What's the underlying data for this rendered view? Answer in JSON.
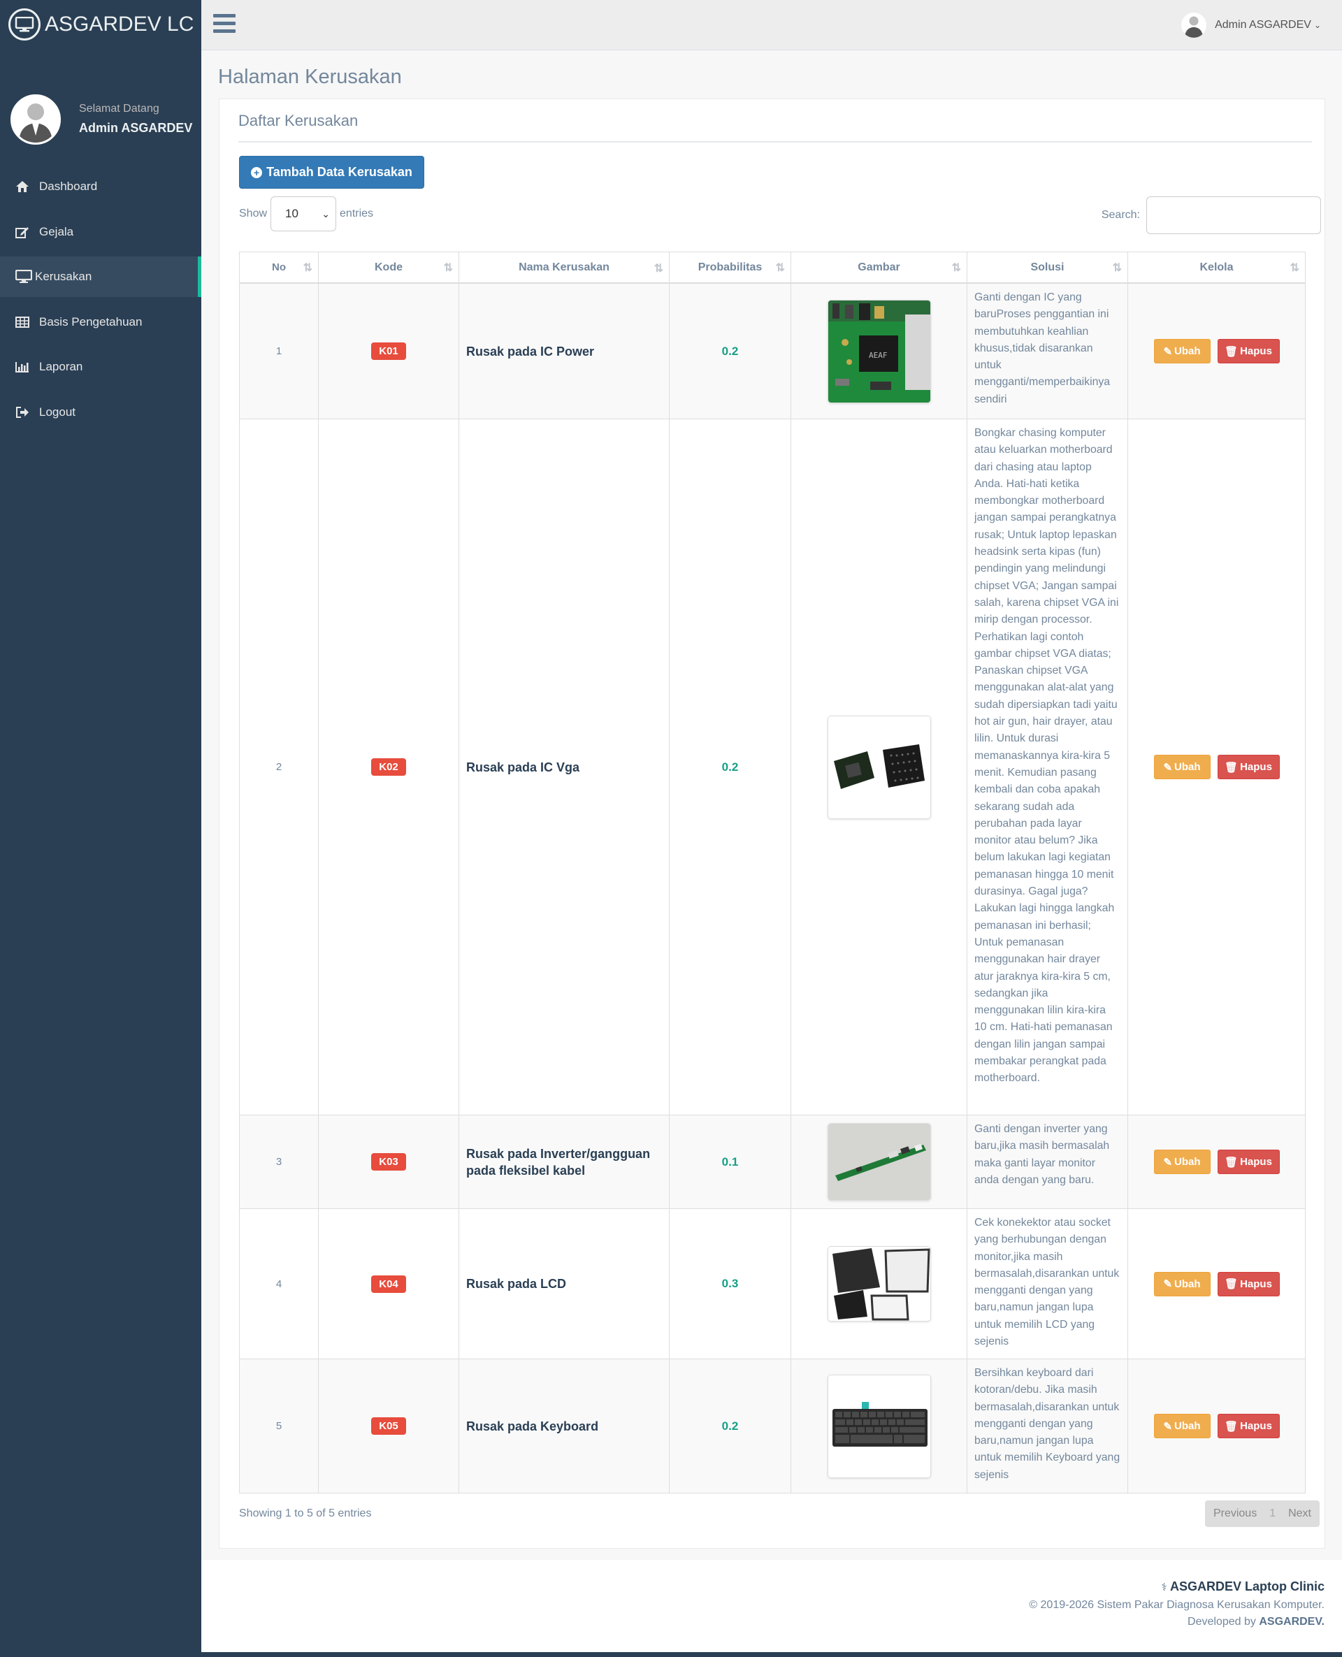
{
  "brand": {
    "title": "ASGARDEV LC"
  },
  "profile": {
    "welcome": "Selamat Datang",
    "name": "Admin ASGARDEV"
  },
  "menu": [
    {
      "label": "Dashboard",
      "icon": "home-icon"
    },
    {
      "label": "Gejala",
      "icon": "edit-icon"
    },
    {
      "label": "Kerusakan",
      "icon": "desktop-icon"
    },
    {
      "label": "Basis Pengetahuan",
      "icon": "table-icon"
    },
    {
      "label": "Laporan",
      "icon": "bar-chart-icon"
    },
    {
      "label": "Logout",
      "icon": "sign-out-icon"
    }
  ],
  "topbar": {
    "user_name": "Admin ASGARDEV"
  },
  "page": {
    "title": "Halaman Kerusakan"
  },
  "panel": {
    "title": "Daftar Kerusakan",
    "add_button": "Tambah Data Kerusakan"
  },
  "table_controls": {
    "show_label": "Show",
    "page_length": "10",
    "entries_label": "entries",
    "search_label": "Search:"
  },
  "table": {
    "columns": [
      "No",
      "Kode",
      "Nama Kerusakan",
      "Probabilitas",
      "Gambar",
      "Solusi",
      "Kelola"
    ],
    "rows": [
      {
        "no": "1",
        "kode": "K01",
        "nama": "Rusak pada IC Power",
        "prob": "0.2",
        "solusi": "Ganti dengan IC yang baruProses penggantian ini membutuhkan keahlian khusus,tidak disarankan untuk mengganti/memperbaikinya sendiri",
        "edit": "Ubah",
        "delete": "Hapus"
      },
      {
        "no": "2",
        "kode": "K02",
        "nama": "Rusak pada IC Vga",
        "prob": "0.2",
        "solusi": "Bongkar chasing komputer atau keluarkan motherboard dari chasing atau laptop Anda. Hati-hati ketika membongkar motherboard jangan sampai perangkatnya rusak; Untuk laptop lepaskan headsink serta kipas (fun) pendingin yang melindungi chipset VGA; Jangan sampai salah, karena chipset VGA ini mirip dengan processor. Perhatikan lagi contoh gambar chipset VGA diatas; Panaskan chipset VGA menggunakan alat-alat yang sudah dipersiapkan tadi yaitu hot air gun, hair drayer, atau lilin. Untuk durasi memanaskannya kira-kira 5 menit. Kemudian pasang kembali dan coba apakah sekarang sudah ada perubahan pada layar monitor atau belum? Jika belum lakukan lagi kegiatan pemanasan hingga 10 menit durasinya. Gagal juga? Lakukan lagi hingga langkah pemanasan ini berhasil; Untuk pemanasan menggunakan hair drayer atur jaraknya kira-kira 5 cm, sedangkan jika menggunakan lilin kira-kira 10 cm. Hati-hati pemanasan dengan lilin jangan sampai membakar perangkat pada motherboard.",
        "edit": "Ubah",
        "delete": "Hapus"
      },
      {
        "no": "3",
        "kode": "K03",
        "nama": "Rusak pada Inverter/gangguan pada fleksibel kabel",
        "prob": "0.1",
        "solusi": "Ganti dengan inverter yang baru,jika masih bermasalah maka ganti layar monitor anda dengan yang baru.",
        "edit": "Ubah",
        "delete": "Hapus"
      },
      {
        "no": "4",
        "kode": "K04",
        "nama": "Rusak pada LCD",
        "prob": "0.3",
        "solusi": "Cek konekektor atau socket yang berhubungan dengan monitor,jika masih bermasalah,disarankan untuk mengganti dengan yang baru,namun jangan lupa untuk memilih LCD yang sejenis",
        "edit": "Ubah",
        "delete": "Hapus"
      },
      {
        "no": "5",
        "kode": "K05",
        "nama": "Rusak pada Keyboard",
        "prob": "0.2",
        "solusi": "Bersihkan keyboard dari kotoran/debu. Jika masih bermasalah,disarankan untuk mengganti dengan yang baru,namun jangan lupa untuk memilih Keyboard yang sejenis",
        "edit": "Ubah",
        "delete": "Hapus"
      }
    ]
  },
  "table_footer": {
    "info": "Showing 1 to 5 of 5 entries",
    "prev": "Previous",
    "page": "1",
    "next": "Next"
  },
  "footer": {
    "brand": "ASGARDEV Laptop Clinic",
    "copyright": "© 2019-2026 Sistem Pakar Diagnosa Kerusakan Komputer.",
    "developed_by": "Developed by",
    "developer": "ASGARDEV."
  },
  "colors": {
    "sidebar": "#2a3f54",
    "accent": "#1abb9c",
    "primary": "#337ab7",
    "danger": "#e74c3c",
    "warning": "#f0ad4e",
    "prob": "#169f85"
  }
}
